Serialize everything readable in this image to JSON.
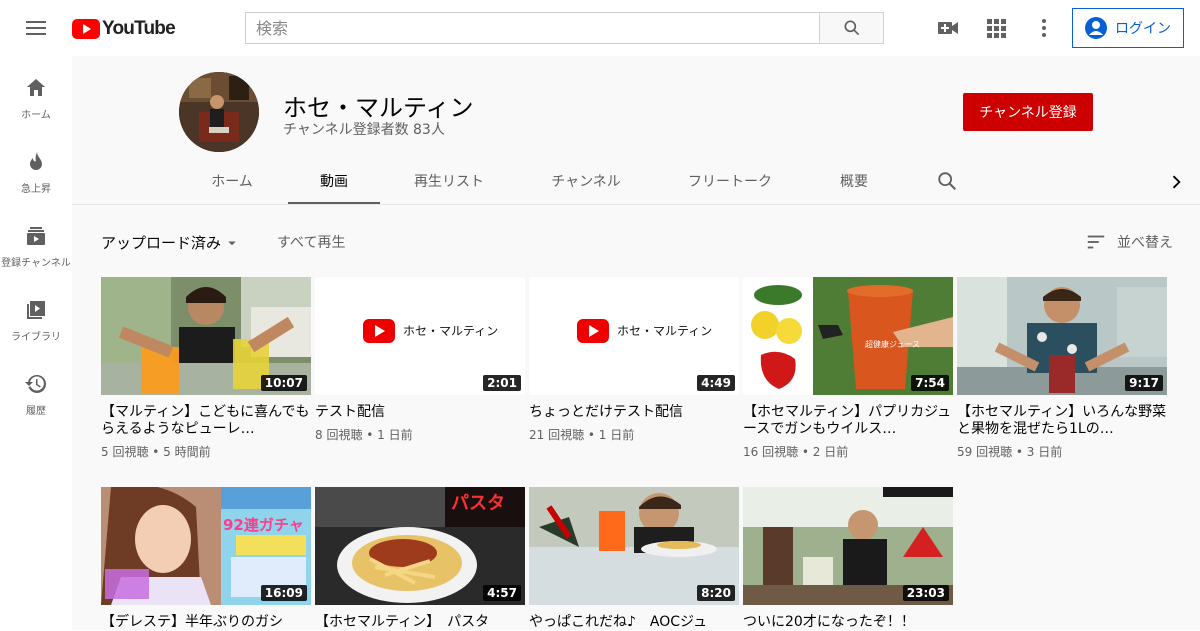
{
  "header": {
    "logo_text": "YouTube",
    "search_placeholder": "検索",
    "login_label": "ログイン"
  },
  "sidebar": {
    "items": [
      {
        "label": "ホーム",
        "icon": "home-icon"
      },
      {
        "label": "急上昇",
        "icon": "trending-icon"
      },
      {
        "label": "登録チャンネル",
        "icon": "subscriptions-icon"
      },
      {
        "label": "ライブラリ",
        "icon": "library-icon"
      },
      {
        "label": "履歴",
        "icon": "history-icon"
      }
    ]
  },
  "channel": {
    "name": "ホセ・マルティン",
    "subscribers": "チャンネル登録者数 83人",
    "subscribe_label": "チャンネル登録"
  },
  "tabs": [
    {
      "label": "ホーム"
    },
    {
      "label": "動画"
    },
    {
      "label": "再生リスト"
    },
    {
      "label": "チャンネル"
    },
    {
      "label": "フリートーク"
    },
    {
      "label": "概要"
    }
  ],
  "toolbar": {
    "uploads_label": "アップロード済み",
    "play_all_label": "すべて再生",
    "sort_label": "並べ替え"
  },
  "videos": [
    {
      "title": "【マルティン】こどもに喜んでもらえるようなピューレ…",
      "meta": "5 回視聴 • 5 時間前",
      "duration": "10:07"
    },
    {
      "title": "テスト配信",
      "meta": "8 回視聴 • 1 日前",
      "duration": "2:01",
      "thumb_text": "ホセ・マルティン"
    },
    {
      "title": "ちょっとだけテスト配信",
      "meta": "21 回視聴 • 1 日前",
      "duration": "4:49",
      "thumb_text": "ホセ・マルティン"
    },
    {
      "title": "【ホセマルティン】パプリカジュースでガンもウイルス…",
      "meta": "16 回視聴 • 2 日前",
      "duration": "7:54",
      "thumb_text": "超健康ジュース"
    },
    {
      "title": "【ホセマルティン】いろんな野菜と果物を混ぜたら1Lの…",
      "meta": "59 回視聴 • 3 日前",
      "duration": "9:17"
    },
    {
      "title": "【デレステ】半年ぶりのガシ",
      "meta": "",
      "duration": "16:09",
      "thumb_text": "92連ガチャ"
    },
    {
      "title": "【ホセマルティン】　パスタ",
      "meta": "",
      "duration": "4:57",
      "thumb_text": "パスタ"
    },
    {
      "title": "やっぱこれだね♪　AOCジュ",
      "meta": "",
      "duration": "8:20"
    },
    {
      "title": "ついに20才になったぞ！！",
      "meta": "",
      "duration": "23:03"
    }
  ],
  "colors": {
    "brand_red": "#ff0000",
    "subscribe_red": "#cc0000",
    "link_blue": "#065fd4"
  }
}
